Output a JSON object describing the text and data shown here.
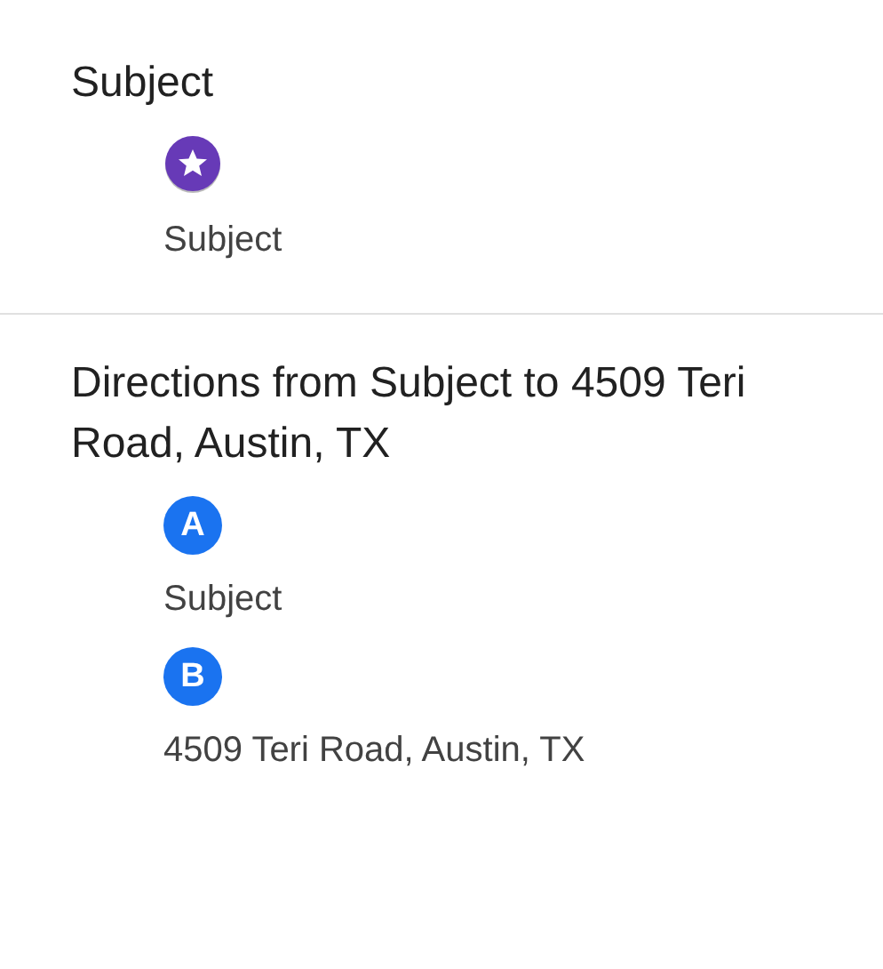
{
  "sections": [
    {
      "title": "Subject",
      "waypoints": [
        {
          "kind": "star",
          "label": "Subject"
        }
      ]
    },
    {
      "title": "Directions from Subject to 4509 Teri Road, Austin, TX",
      "waypoints": [
        {
          "kind": "letter",
          "marker": "A",
          "label": "Subject"
        },
        {
          "kind": "letter",
          "marker": "B",
          "label": "4509 Teri Road, Austin, TX"
        }
      ]
    }
  ]
}
